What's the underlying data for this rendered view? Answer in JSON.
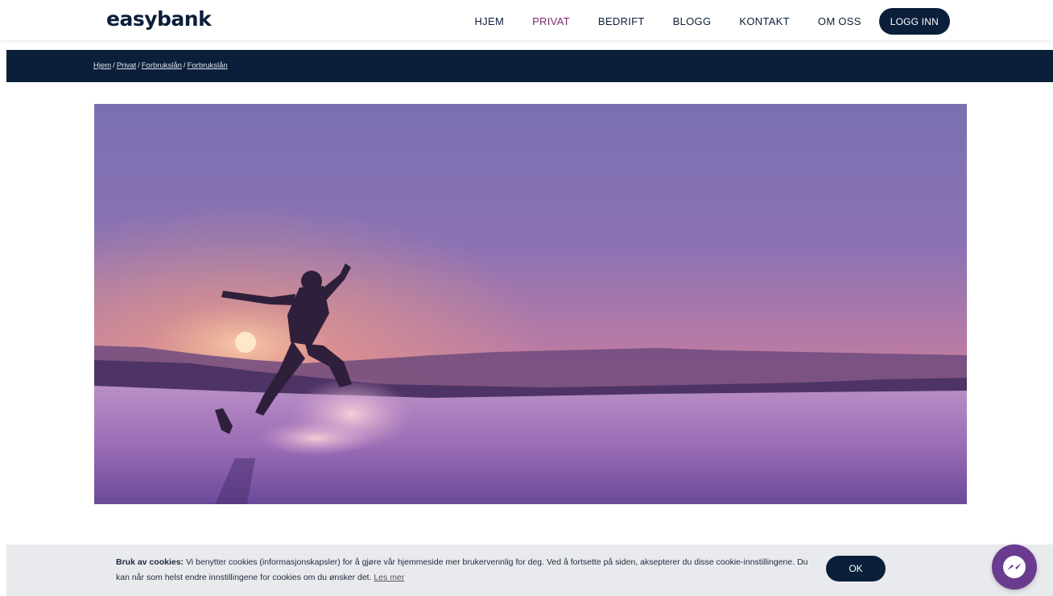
{
  "brand": {
    "logo_text": "easybank"
  },
  "nav": {
    "items": [
      {
        "label": "HJEM"
      },
      {
        "label": "PRIVAT"
      },
      {
        "label": "BEDRIFT"
      },
      {
        "label": "BLOGG"
      },
      {
        "label": "KONTAKT"
      },
      {
        "label": "OM OSS"
      }
    ],
    "login_label": "LOGG INN"
  },
  "breadcrumb": {
    "items": [
      "Hjem",
      "Privat",
      "Forbrukslån",
      "Forbrukslån"
    ],
    "separator": "/"
  },
  "cookie": {
    "title": "Bruk av cookies:",
    "text": "Vi benytter cookies (informasjonskapsler) for å gjøre vår hjemmeside mer brukervennlig for deg. Ved å fortsette på siden, aksepterer du disse cookie-innstillingene. Du kan når som helst endre innstillingene for cookies om du ønsker det.",
    "link_label": "Les mer",
    "ok_label": "OK"
  },
  "icons": {
    "chat": "messenger-icon"
  },
  "colors": {
    "navy": "#0b1f3a",
    "active_nav": "#7a2a6e",
    "cookie_bg": "#e9eaee",
    "messenger": "#6b3b8f"
  }
}
